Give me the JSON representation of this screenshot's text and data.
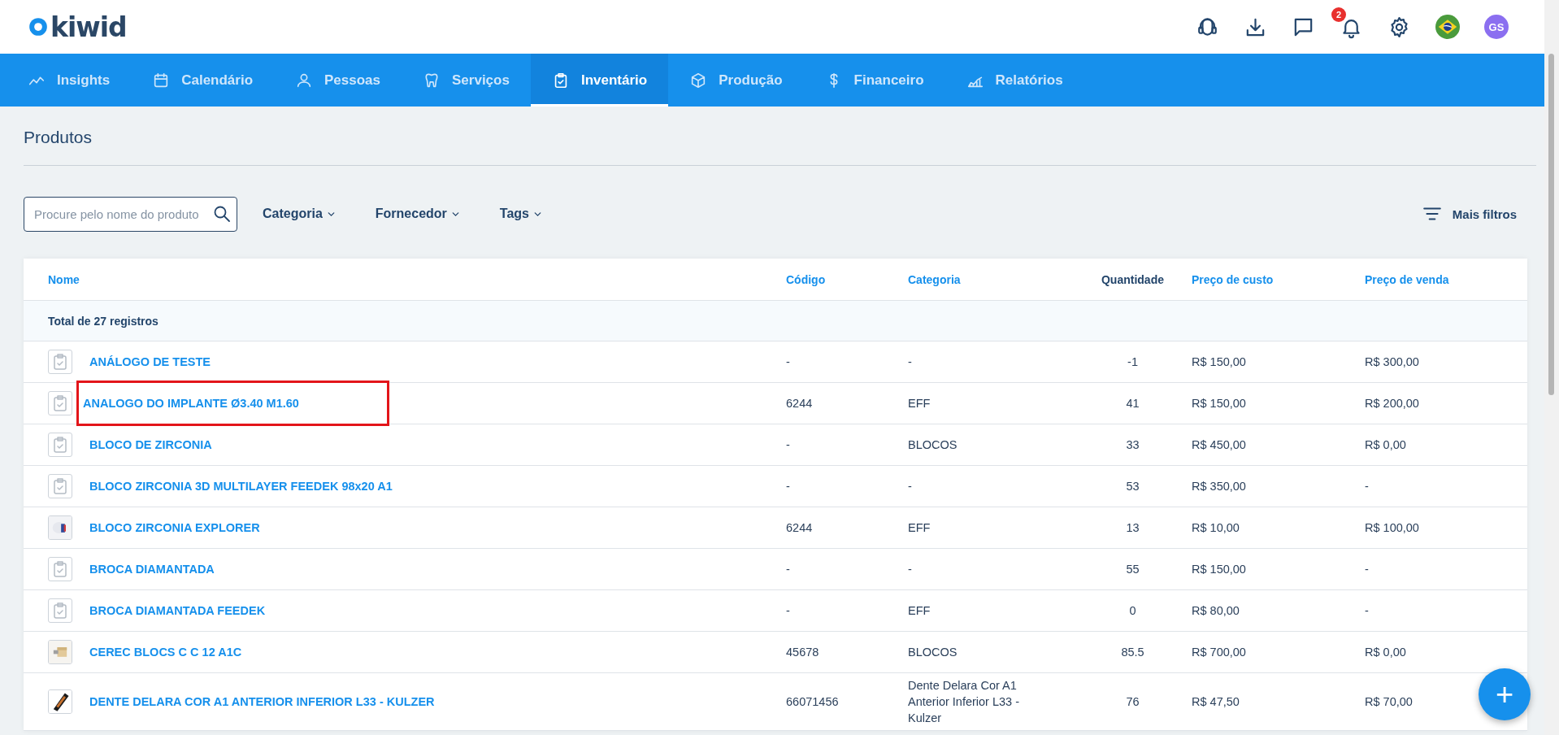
{
  "header": {
    "logo": "kiwid",
    "notifications": {
      "count": "2"
    },
    "avatar": {
      "initials": "GS"
    }
  },
  "nav": [
    {
      "label": "Insights",
      "selected": false
    },
    {
      "label": "Calendário",
      "selected": false
    },
    {
      "label": "Pessoas",
      "selected": false
    },
    {
      "label": "Serviços",
      "selected": false
    },
    {
      "label": "Inventário",
      "selected": true
    },
    {
      "label": "Produção",
      "selected": false
    },
    {
      "label": "Financeiro",
      "selected": false
    },
    {
      "label": "Relatórios",
      "selected": false
    }
  ],
  "page_title": "Produtos",
  "filters": {
    "search": {
      "placeholder": "Procure pelo nome do produto"
    },
    "dropdowns": [
      "Categoria",
      "Fornecedor",
      "Tags"
    ],
    "more": "Mais filtros"
  },
  "table": {
    "columns": [
      {
        "label": "Nome",
        "kind": "link"
      },
      {
        "label": "Código",
        "kind": "link"
      },
      {
        "label": "Categoria",
        "kind": "link"
      },
      {
        "label": "Quantidade",
        "kind": "plain"
      },
      {
        "label": "Preço de custo",
        "kind": "link"
      },
      {
        "label": "Preço de venda",
        "kind": "link"
      }
    ],
    "total": "Total de 27 registros",
    "rows": [
      {
        "kind": "clipboard",
        "highlighted": false,
        "cells": [
          "ANÁLOGO DE TESTE",
          "-",
          "-",
          "-1",
          "R$ 150,00",
          "R$ 300,00"
        ]
      },
      {
        "kind": "clipboard",
        "highlighted": true,
        "cells": [
          "ANALOGO DO IMPLANTE Ø3.40 M1.60",
          "6244",
          "EFF",
          "41",
          "R$ 150,00",
          "R$ 200,00"
        ]
      },
      {
        "kind": "clipboard",
        "highlighted": false,
        "cells": [
          "BLOCO DE ZIRCONIA",
          "-",
          "BLOCOS",
          "33",
          "R$ 450,00",
          "R$ 0,00"
        ]
      },
      {
        "kind": "clipboard",
        "highlighted": false,
        "cells": [
          "BLOCO ZIRCONIA 3D MULTILAYER FEEDEK 98x20 A1",
          "-",
          "-",
          "53",
          "R$ 350,00",
          "-"
        ]
      },
      {
        "kind": "picture",
        "highlighted": false,
        "cells": [
          "BLOCO ZIRCONIA EXPLORER",
          "6244",
          "EFF",
          "13",
          "R$ 10,00",
          "R$ 100,00"
        ]
      },
      {
        "kind": "clipboard",
        "highlighted": false,
        "cells": [
          "BROCA DIAMANTADA",
          "-",
          "-",
          "55",
          "R$ 150,00",
          "-"
        ]
      },
      {
        "kind": "clipboard",
        "highlighted": false,
        "cells": [
          "BROCA DIAMANTADA FEEDEK",
          "-",
          "EFF",
          "0",
          "R$ 80,00",
          "-"
        ]
      },
      {
        "kind": "picture",
        "highlighted": false,
        "cells": [
          "CEREC BLOCS C C 12 A1C",
          "45678",
          "BLOCOS",
          "85.5",
          "R$ 700,00",
          "R$ 0,00"
        ]
      },
      {
        "kind": "picture",
        "highlighted": false,
        "cells": [
          "DENTE DELARA COR A1 ANTERIOR INFERIOR L33 - KULZER",
          "66071456",
          "Dente Delara Cor A1 Anterior Inferior L33 - Kulzer",
          "76",
          "R$ 47,50",
          "R$ 70,00"
        ]
      }
    ]
  },
  "fab": {
    "label": "+"
  }
}
